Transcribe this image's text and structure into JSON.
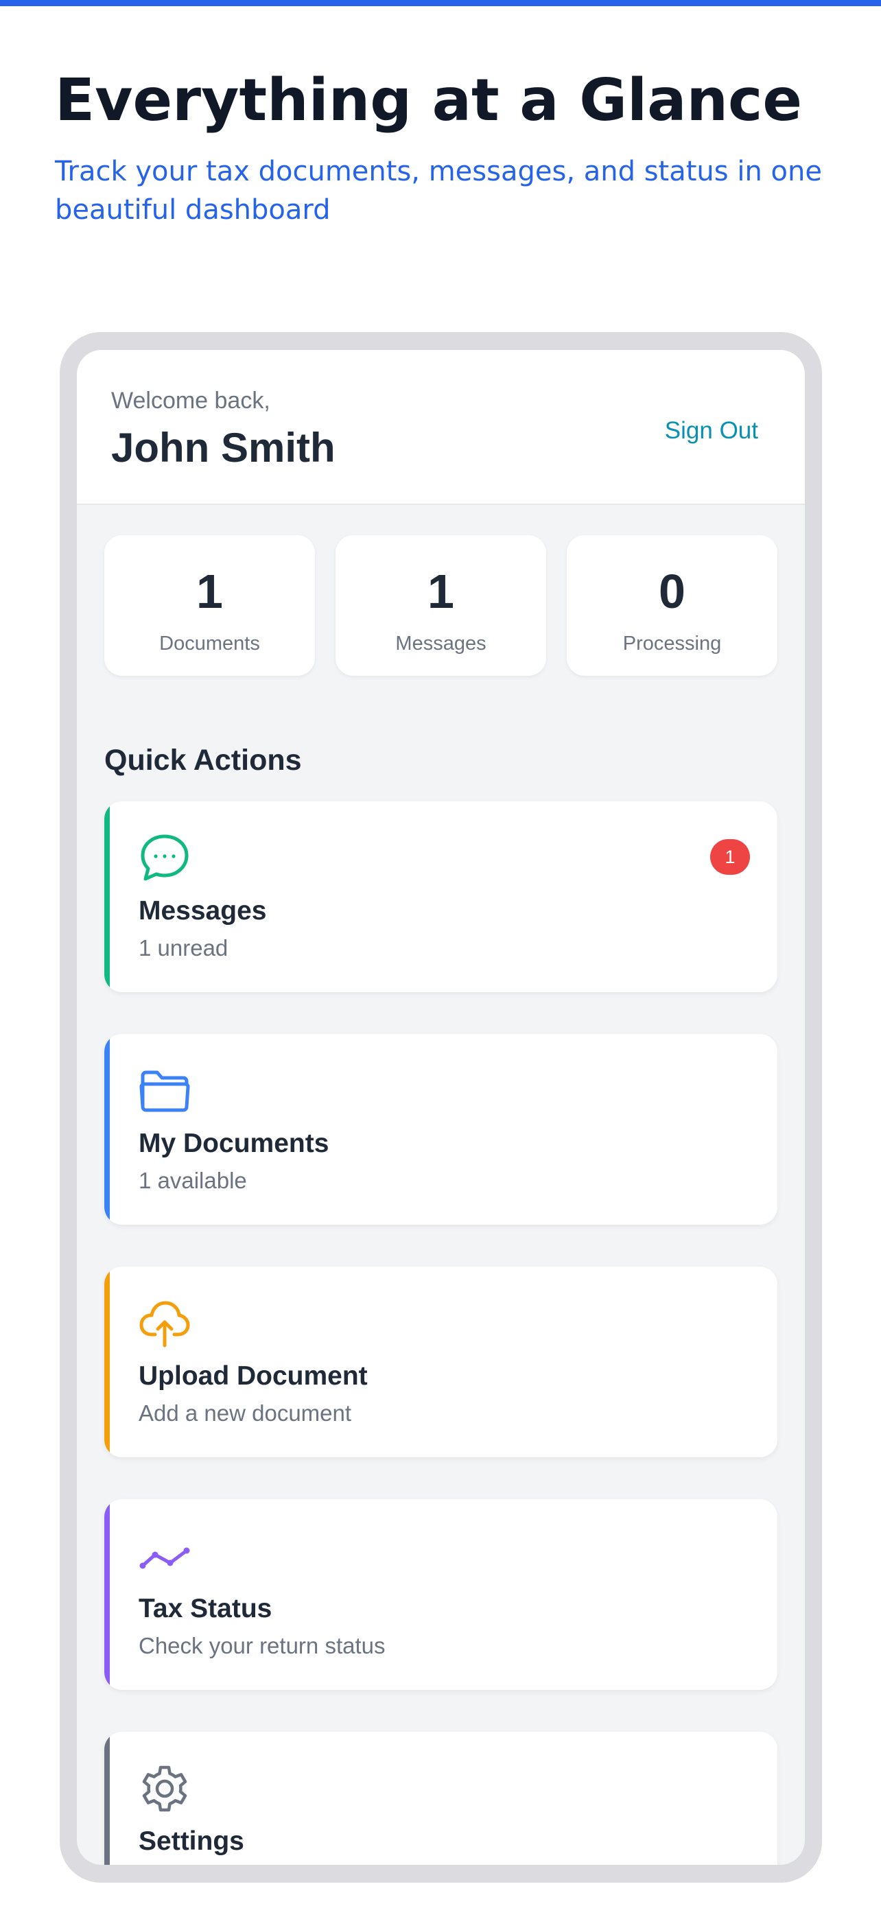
{
  "hero": {
    "title": "Everything at a Glance",
    "subtitle": "Track your tax documents, messages, and status in one beautiful dashboard"
  },
  "header": {
    "welcome": "Welcome back,",
    "user_name": "John Smith",
    "sign_out_label": "Sign Out"
  },
  "stats": [
    {
      "value": "1",
      "label": "Documents"
    },
    {
      "value": "1",
      "label": "Messages"
    },
    {
      "value": "0",
      "label": "Processing"
    }
  ],
  "quick_actions": {
    "title": "Quick Actions",
    "items": [
      {
        "title": "Messages",
        "subtitle": "1 unread",
        "icon": "chat-bubble-icon",
        "accent": "#10b981",
        "badge": "1",
        "badge_color": "#ef4444"
      },
      {
        "title": "My Documents",
        "subtitle": "1 available",
        "icon": "folder-icon",
        "accent": "#3b82f6"
      },
      {
        "title": "Upload Document",
        "subtitle": "Add a new document",
        "icon": "cloud-upload-icon",
        "accent": "#f59e0b"
      },
      {
        "title": "Tax Status",
        "subtitle": "Check your return status",
        "icon": "trend-line-icon",
        "accent": "#8b5cf6"
      },
      {
        "title": "Settings",
        "subtitle": "",
        "icon": "gear-icon",
        "accent": "#6b7280"
      }
    ]
  },
  "colors": {
    "brand": "#2563eb",
    "link": "#0891b2"
  }
}
